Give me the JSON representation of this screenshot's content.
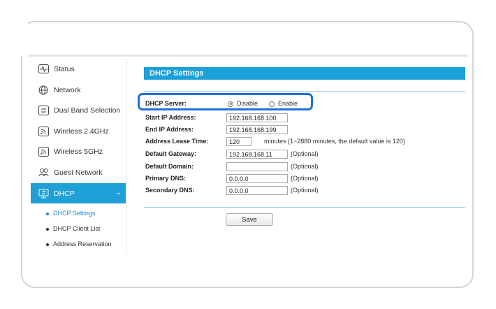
{
  "sidebar": {
    "items": [
      {
        "label": "Status",
        "icon": "status-pulse-icon"
      },
      {
        "label": "Network",
        "icon": "globe-icon"
      },
      {
        "label": "Dual Band Selection",
        "icon": "dual-band-icon"
      },
      {
        "label": "Wireless 2.4GHz",
        "icon": "wireless-icon"
      },
      {
        "label": "Wireless 5GHz",
        "icon": "wireless-icon"
      },
      {
        "label": "Guest Network",
        "icon": "guest-users-icon"
      },
      {
        "label": "DHCP",
        "icon": "dhcp-monitor-icon"
      }
    ],
    "subitems": [
      {
        "label": "DHCP Settings"
      },
      {
        "label": "DHCP Client List"
      },
      {
        "label": "Address Reservation"
      }
    ],
    "active_color": "#1fa0d6"
  },
  "main": {
    "title": "DHCP Settings",
    "dhcp_server": {
      "label": "DHCP Server:",
      "option_disable": "Disable",
      "option_enable": "Enable",
      "selected": "Disable"
    },
    "start_ip": {
      "label": "Start IP Address:",
      "value": "192.168.168.100"
    },
    "end_ip": {
      "label": "End IP Address:",
      "value": "192.168.168.199"
    },
    "lease": {
      "label": "Address Lease Time:",
      "value": "120",
      "hint": "minutes (1~2880 minutes, the default value is 120)"
    },
    "gateway": {
      "label": "Default Gateway:",
      "value": "192.168.168.11",
      "hint": "(Optional)"
    },
    "domain": {
      "label": "Default Domain:",
      "value": "",
      "hint": "(Optional)"
    },
    "primary_dns": {
      "label": "Primary DNS:",
      "value": "0.0.0.0",
      "hint": "(Optional)"
    },
    "secondary_dns": {
      "label": "Secondary DNS:",
      "value": "0.0.0.0",
      "hint": "(Optional)"
    },
    "save_label": "Save"
  },
  "colors": {
    "accent": "#1ba0d8",
    "highlight": "#1e6fe0"
  }
}
